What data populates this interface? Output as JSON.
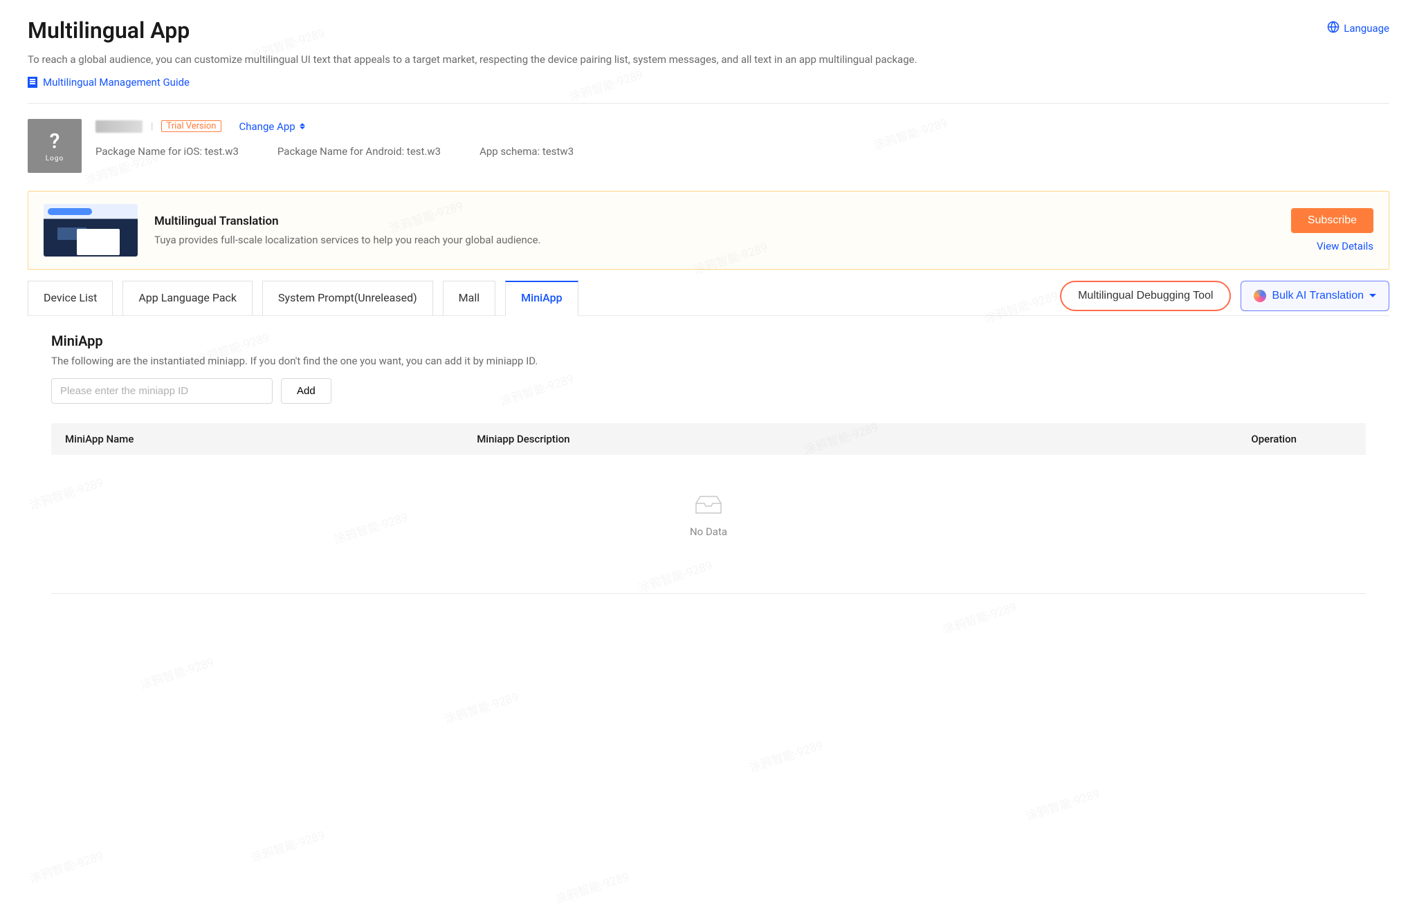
{
  "header": {
    "title": "Multilingual App",
    "language_label": "Language",
    "subtitle": "To reach a global audience, you can customize multilingual UI text that appeals to a target market, respecting the device pairing list, system messages, and all text in an app multilingual package.",
    "guide_link": "Multilingual Management Guide"
  },
  "app_info": {
    "logo_text": "Logo",
    "trial_label": "Trial Version",
    "change_app_label": "Change App",
    "ios_label": "Package Name for iOS: test.w3",
    "android_label": "Package Name for Android: test.w3",
    "schema_label": "App schema: testw3"
  },
  "promo": {
    "title": "Multilingual Translation",
    "desc": "Tuya provides full-scale localization services to help you reach your global audience.",
    "subscribe_label": "Subscribe",
    "view_details_label": "View Details"
  },
  "tabs": {
    "device_list": "Device List",
    "app_lang_pack": "App Language Pack",
    "system_prompt": "System Prompt(Unreleased)",
    "mall": "Mall",
    "miniapp": "MiniApp"
  },
  "buttons": {
    "debug_tool": "Multilingual Debugging Tool",
    "bulk_ai": "Bulk AI Translation"
  },
  "miniapp_section": {
    "title": "MiniApp",
    "desc": "The following are the instantiated miniapp. If you don't find the one you want, you can add it by miniapp ID.",
    "input_placeholder": "Please enter the miniapp ID",
    "add_label": "Add"
  },
  "table": {
    "col_name": "MiniApp Name",
    "col_desc": "Miniapp Description",
    "col_op": "Operation",
    "no_data": "No Data"
  },
  "watermark_text": "涂鸦智能-9289"
}
